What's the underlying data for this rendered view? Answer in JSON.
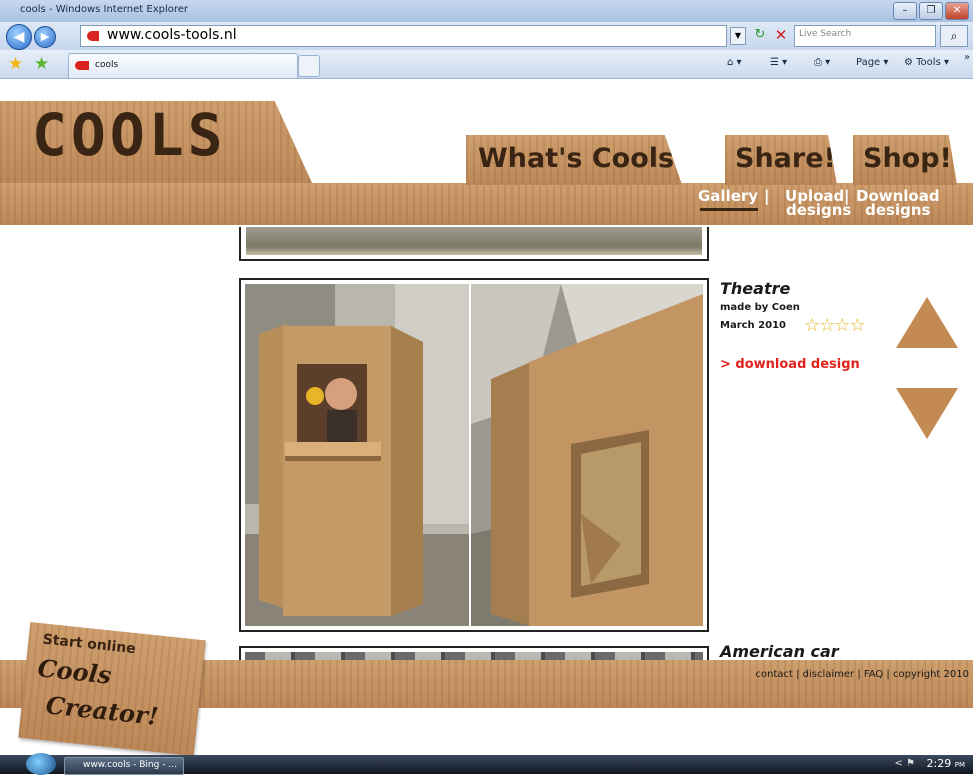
{
  "window": {
    "title": "cools - Windows Internet Explorer",
    "minimize": "–",
    "maximize": "❐",
    "close": "✕"
  },
  "navbar": {
    "back": "◀",
    "forward": "▶",
    "url": "www.cools-tools.nl",
    "dropdown": "▼",
    "refresh": "↻",
    "stop": "✕",
    "search_placeholder": "Live Search",
    "search_glyph": "⌕"
  },
  "tabbar": {
    "tab_label": "cools",
    "tools": {
      "home": "⌂ ▾",
      "feeds": "☰ ▾",
      "print": "⎙ ▾",
      "page": "Page ▾",
      "tools": "⚙ Tools ▾",
      "more": "»"
    }
  },
  "site": {
    "logo": "COOLS",
    "nav": {
      "whats_cools": "What's Cools?",
      "share": "Share!",
      "shop": "Shop!"
    },
    "subnav": {
      "gallery": "Gallery",
      "upload_1": "Upload",
      "upload_2": "designs",
      "download_1": "Download",
      "download_2": "designs",
      "sep": "|"
    },
    "item": {
      "title": "Theatre",
      "made_by": "made by Coen",
      "date": "March 2010",
      "rating": 4,
      "stars": "☆☆☆☆",
      "download": "> download design"
    },
    "next_item_title": "American car",
    "footer": "contact | disclaimer | FAQ | copyright 2010",
    "creator": {
      "line1": "Start online",
      "line2": "Cools",
      "line3": "Creator!"
    }
  },
  "taskbar": {
    "task": "www.cools - Bing - ...",
    "tray": "< ⚑",
    "time": "2:29",
    "ampm": "PM"
  },
  "colors": {
    "cardboard": "#c99868",
    "link_red": "#e2221c",
    "arrow": "#c48a53",
    "ink": "#3a2413"
  }
}
